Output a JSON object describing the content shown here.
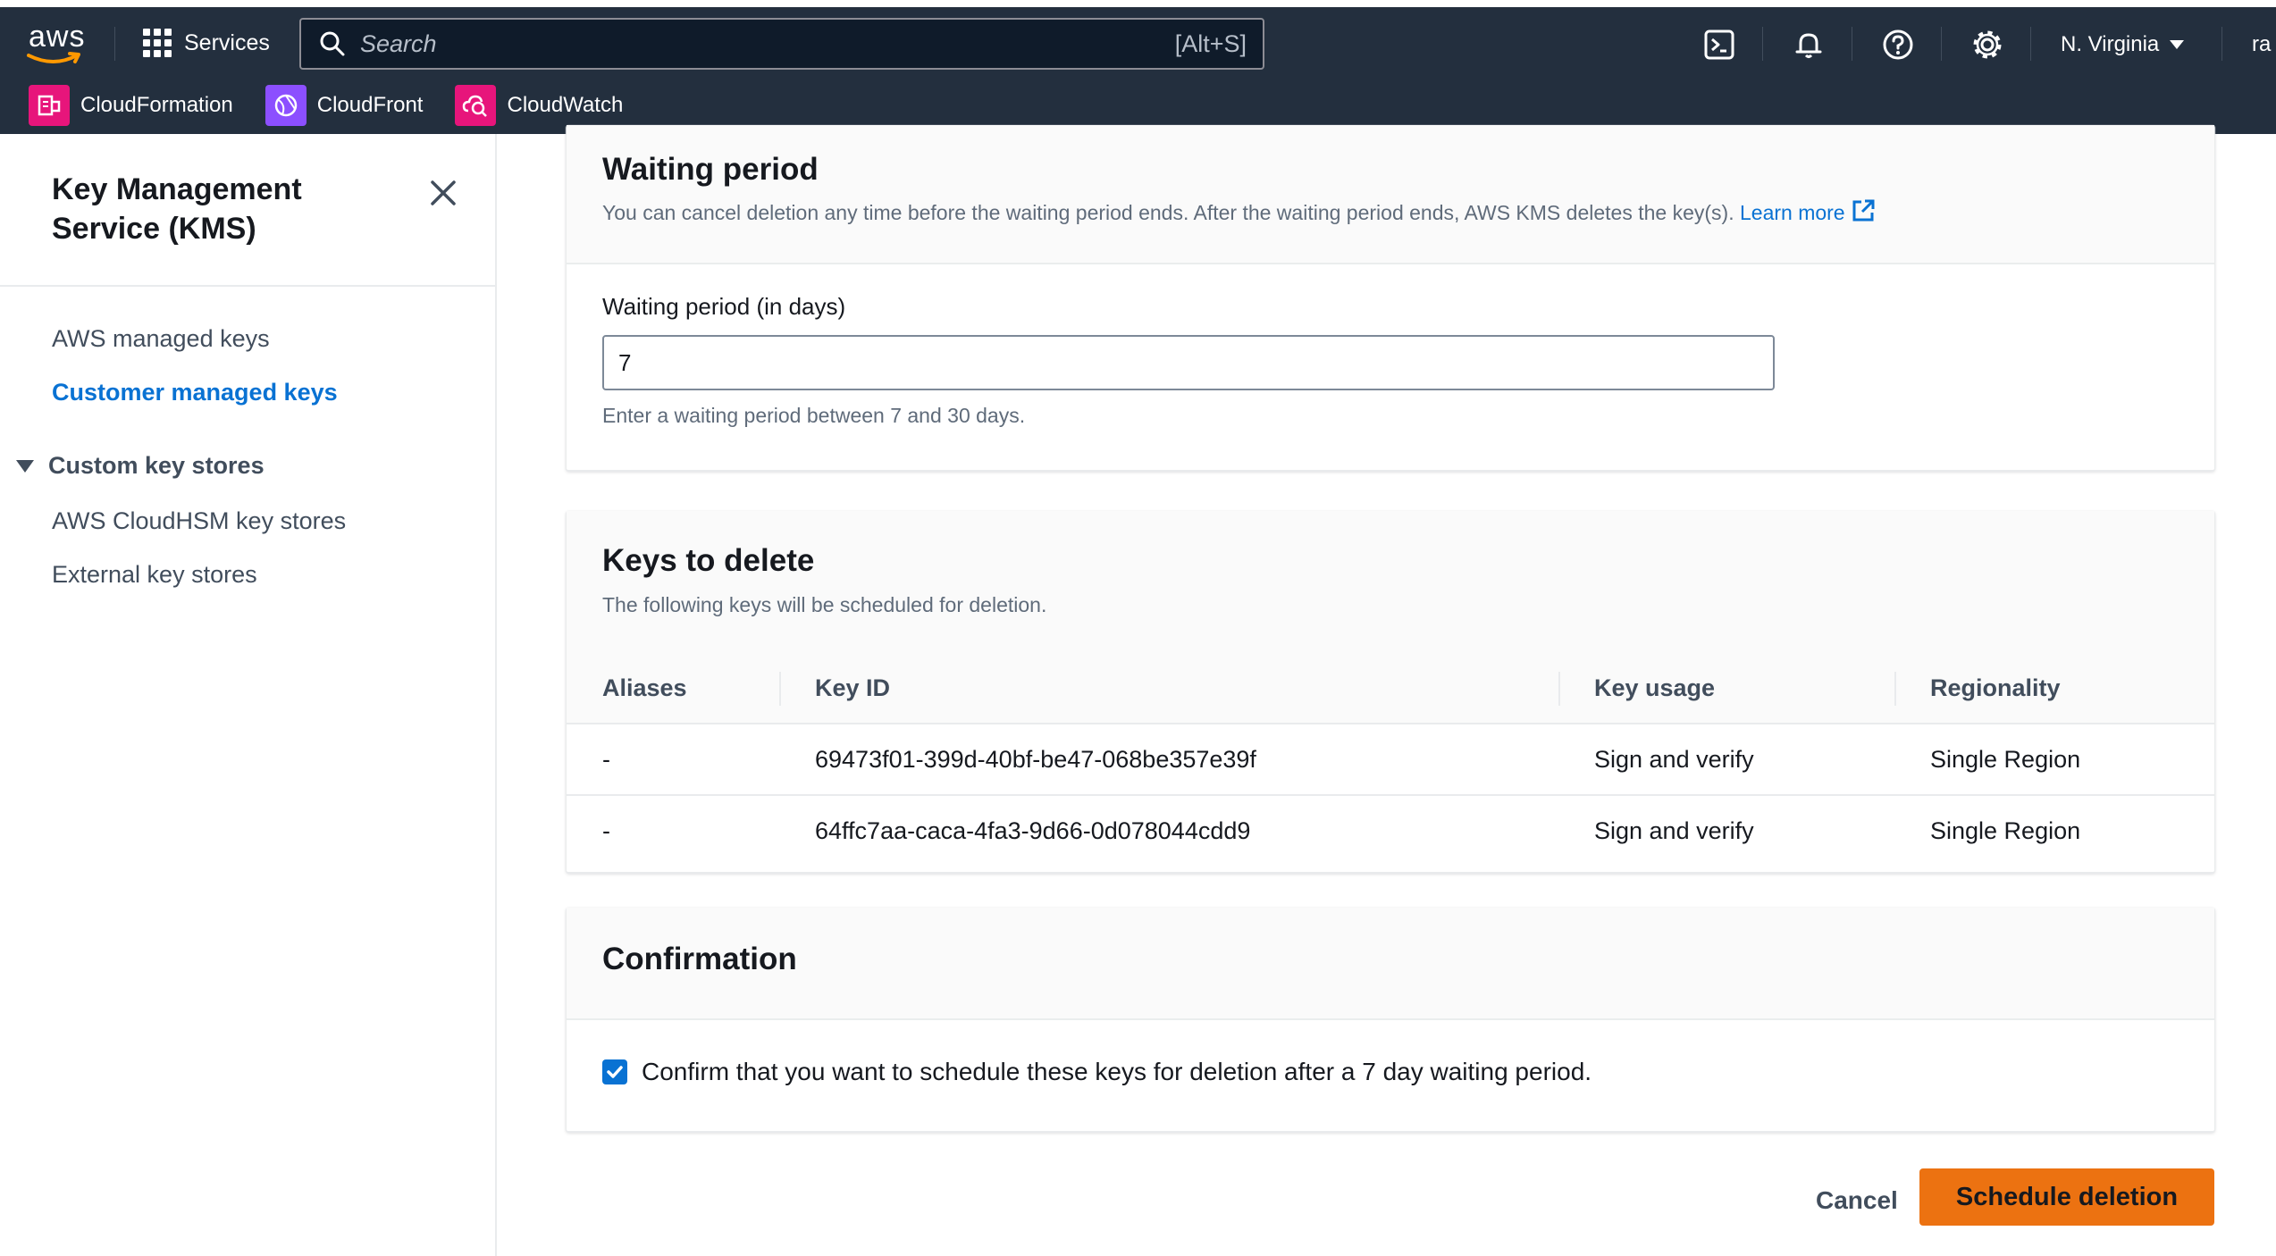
{
  "topnav": {
    "logo_text": "aws",
    "services_label": "Services",
    "search_placeholder": "Search",
    "search_shortcut": "[Alt+S]",
    "region_label": "N. Virginia",
    "account_label": "ra",
    "favorites": [
      {
        "label": "CloudFormation",
        "color": "#e7157b"
      },
      {
        "label": "CloudFront",
        "color": "#8c4fff"
      },
      {
        "label": "CloudWatch",
        "color": "#e7157b"
      }
    ]
  },
  "sidebar": {
    "title": "Key Management Service (KMS)",
    "items": [
      "AWS managed keys",
      "Customer managed keys"
    ],
    "active_item": "Customer managed keys",
    "section_title": "Custom key stores",
    "section_items": [
      "AWS CloudHSM key stores",
      "External key stores"
    ]
  },
  "waiting_period": {
    "heading": "Waiting period",
    "description": "You can cancel deletion any time before the waiting period ends. After the waiting period ends, AWS KMS deletes the key(s).",
    "learn_more": "Learn more",
    "field_label": "Waiting period (in days)",
    "field_value": "7",
    "constraint": "Enter a waiting period between 7 and 30 days."
  },
  "keys_to_delete": {
    "heading": "Keys to delete",
    "description": "The following keys will be scheduled for deletion.",
    "columns": [
      "Aliases",
      "Key ID",
      "Key usage",
      "Regionality"
    ],
    "rows": [
      {
        "alias": "-",
        "key_id": "69473f01-399d-40bf-be47-068be357e39f",
        "usage": "Sign and verify",
        "regionality": "Single Region"
      },
      {
        "alias": "-",
        "key_id": "64ffc7aa-caca-4fa3-9d66-0d078044cdd9",
        "usage": "Sign and verify",
        "regionality": "Single Region"
      }
    ]
  },
  "confirmation": {
    "heading": "Confirmation",
    "checkbox_label": "Confirm that you want to schedule these keys for deletion after a 7 day waiting period.",
    "checked": true
  },
  "actions": {
    "cancel_label": "Cancel",
    "primary_label": "Schedule deletion"
  },
  "colors": {
    "nav_bg": "#232f3e",
    "link": "#0972d3",
    "primary_button": "#ec7211"
  }
}
